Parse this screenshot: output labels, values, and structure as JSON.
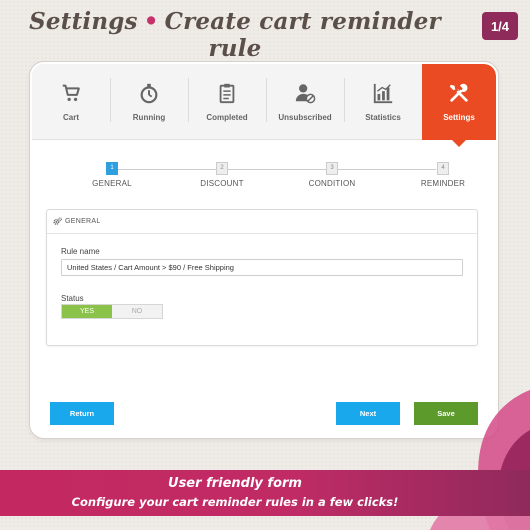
{
  "header": {
    "title_main": "Settings",
    "title_rest": "Create cart reminder rule",
    "separator": "•",
    "page_indicator": "1/4"
  },
  "tabs": [
    {
      "label": "Cart",
      "icon": "cart-icon",
      "active": false
    },
    {
      "label": "Running",
      "icon": "stopwatch-icon",
      "active": false
    },
    {
      "label": "Completed",
      "icon": "clipboard-icon",
      "active": false
    },
    {
      "label": "Unsubscribed",
      "icon": "user-unsubscribe-icon",
      "active": false
    },
    {
      "label": "Statistics",
      "icon": "bar-chart-icon",
      "active": false
    },
    {
      "label": "Settings",
      "icon": "tools-icon",
      "active": true
    }
  ],
  "steps": [
    {
      "number": "1",
      "label": "GENERAL",
      "active": true
    },
    {
      "number": "2",
      "label": "DISCOUNT",
      "active": false
    },
    {
      "number": "3",
      "label": "CONDITION",
      "active": false
    },
    {
      "number": "4",
      "label": "REMINDER",
      "active": false
    }
  ],
  "panel": {
    "title": "GENERAL",
    "icon": "gears-icon",
    "rule_name_label": "Rule name",
    "rule_name_value": "United States / Cart Amount > $90 / Free Shipping",
    "status_label": "Status",
    "status_yes": "YES",
    "status_no": "NO",
    "status_value": "YES"
  },
  "buttons": {
    "return": "Return",
    "next": "Next",
    "save": "Save"
  },
  "banner": {
    "line1": "User friendly form",
    "line2": "Configure your cart reminder rules in a few clicks!"
  },
  "colors": {
    "accent": "#ea4b22",
    "primary_button": "#1aa8ec",
    "save_button": "#5d9a2c",
    "active_step": "#2ea0e0",
    "toggle_on": "#8bc34a",
    "banner": "#c42860",
    "badge": "#8e2b5a"
  }
}
